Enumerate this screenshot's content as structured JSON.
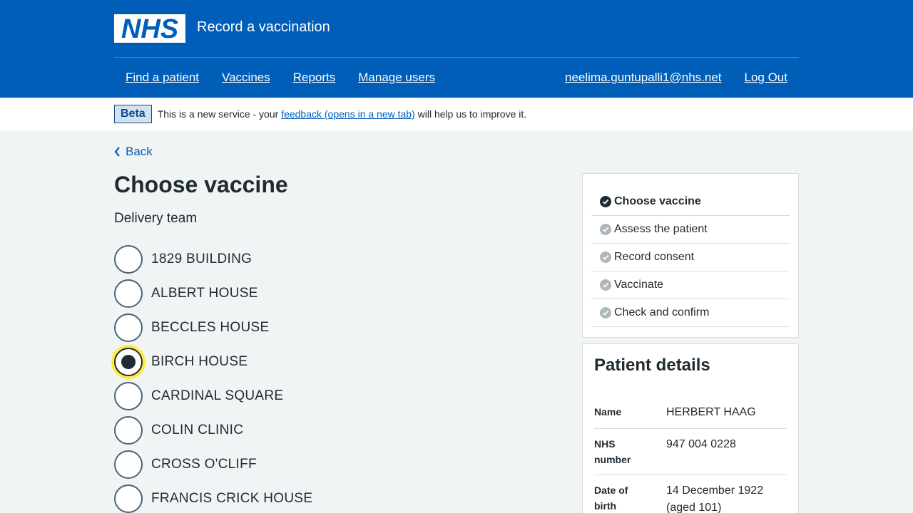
{
  "header": {
    "service_name": "Record a vaccination",
    "nav": [
      "Find a patient",
      "Vaccines",
      "Reports",
      "Manage users"
    ],
    "user_email": "neelima.guntupalli1@nhs.net",
    "logout": "Log Out"
  },
  "phase": {
    "tag": "Beta",
    "text_before": "This is a new service - your ",
    "link": "feedback (opens in a new tab)",
    "text_after": " will help us to improve it."
  },
  "back": "Back",
  "page_title": "Choose vaccine",
  "legend": "Delivery team",
  "options": [
    {
      "label": "1829 BUILDING",
      "checked": false
    },
    {
      "label": "ALBERT HOUSE",
      "checked": false
    },
    {
      "label": "BECCLES HOUSE",
      "checked": false
    },
    {
      "label": "BIRCH HOUSE",
      "checked": true
    },
    {
      "label": "CARDINAL SQUARE",
      "checked": false
    },
    {
      "label": "COLIN CLINIC",
      "checked": false
    },
    {
      "label": "CROSS O'CLIFF",
      "checked": false
    },
    {
      "label": "FRANCIS CRICK HOUSE",
      "checked": false
    }
  ],
  "steps": [
    {
      "label": "Choose vaccine",
      "active": true
    },
    {
      "label": "Assess the patient",
      "active": false
    },
    {
      "label": "Record consent",
      "active": false
    },
    {
      "label": "Vaccinate",
      "active": false
    },
    {
      "label": "Check and confirm",
      "active": false
    }
  ],
  "patient": {
    "title": "Patient details",
    "name_label": "Name",
    "name": "HERBERT HAAG",
    "nhs_label_1": "NHS",
    "nhs_label_2": "number",
    "nhs": "947 004 0228",
    "dob_label_1": "Date of",
    "dob_label_2": "birth",
    "dob_1": "14 December 1922",
    "dob_2": "(aged 101)"
  },
  "colors": {
    "brand": "#005eb8",
    "focus": "#ffeb3b"
  }
}
